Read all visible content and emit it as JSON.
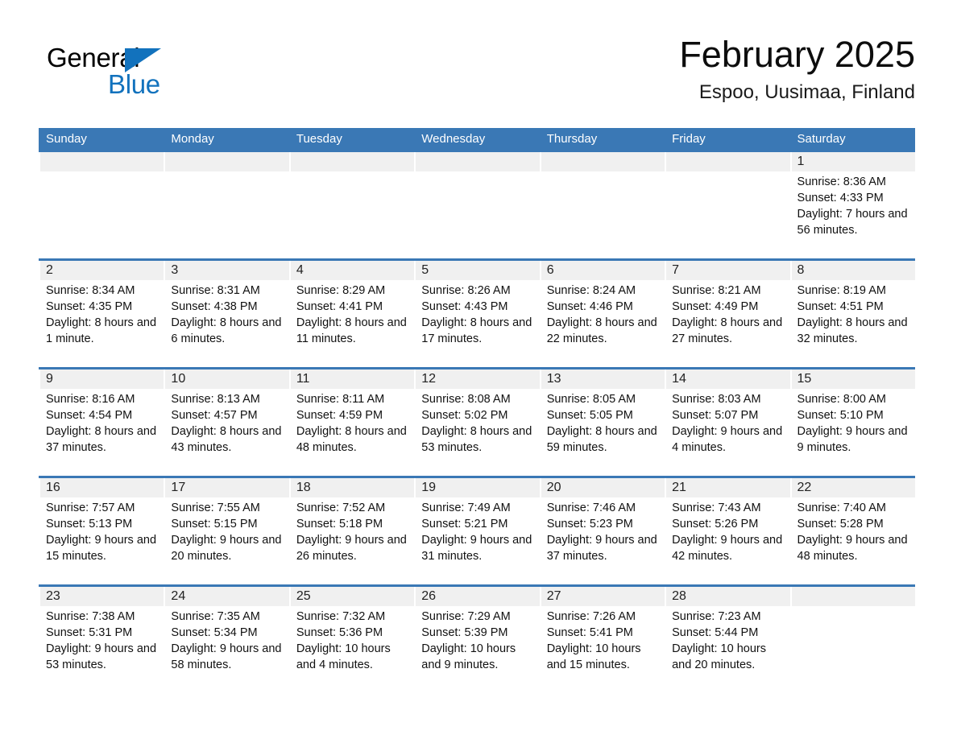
{
  "brand": {
    "name_part1": "General",
    "name_part2": "Blue",
    "triangle_icon": "triangle-icon",
    "colors": {
      "blue": "#1272bd",
      "black": "#000000"
    }
  },
  "header": {
    "title": "February 2025",
    "subtitle": "Espoo, Uusimaa, Finland"
  },
  "theme": {
    "header_blue": "#3a78b5",
    "band_gray": "#f0f0f0",
    "text": "#111111"
  },
  "weekdays": [
    "Sunday",
    "Monday",
    "Tuesday",
    "Wednesday",
    "Thursday",
    "Friday",
    "Saturday"
  ],
  "weeks": [
    [
      {
        "day": "",
        "sunrise": "",
        "sunset": "",
        "daylight": ""
      },
      {
        "day": "",
        "sunrise": "",
        "sunset": "",
        "daylight": ""
      },
      {
        "day": "",
        "sunrise": "",
        "sunset": "",
        "daylight": ""
      },
      {
        "day": "",
        "sunrise": "",
        "sunset": "",
        "daylight": ""
      },
      {
        "day": "",
        "sunrise": "",
        "sunset": "",
        "daylight": ""
      },
      {
        "day": "",
        "sunrise": "",
        "sunset": "",
        "daylight": ""
      },
      {
        "day": "1",
        "sunrise": "Sunrise: 8:36 AM",
        "sunset": "Sunset: 4:33 PM",
        "daylight": "Daylight: 7 hours and 56 minutes."
      }
    ],
    [
      {
        "day": "2",
        "sunrise": "Sunrise: 8:34 AM",
        "sunset": "Sunset: 4:35 PM",
        "daylight": "Daylight: 8 hours and 1 minute."
      },
      {
        "day": "3",
        "sunrise": "Sunrise: 8:31 AM",
        "sunset": "Sunset: 4:38 PM",
        "daylight": "Daylight: 8 hours and 6 minutes."
      },
      {
        "day": "4",
        "sunrise": "Sunrise: 8:29 AM",
        "sunset": "Sunset: 4:41 PM",
        "daylight": "Daylight: 8 hours and 11 minutes."
      },
      {
        "day": "5",
        "sunrise": "Sunrise: 8:26 AM",
        "sunset": "Sunset: 4:43 PM",
        "daylight": "Daylight: 8 hours and 17 minutes."
      },
      {
        "day": "6",
        "sunrise": "Sunrise: 8:24 AM",
        "sunset": "Sunset: 4:46 PM",
        "daylight": "Daylight: 8 hours and 22 minutes."
      },
      {
        "day": "7",
        "sunrise": "Sunrise: 8:21 AM",
        "sunset": "Sunset: 4:49 PM",
        "daylight": "Daylight: 8 hours and 27 minutes."
      },
      {
        "day": "8",
        "sunrise": "Sunrise: 8:19 AM",
        "sunset": "Sunset: 4:51 PM",
        "daylight": "Daylight: 8 hours and 32 minutes."
      }
    ],
    [
      {
        "day": "9",
        "sunrise": "Sunrise: 8:16 AM",
        "sunset": "Sunset: 4:54 PM",
        "daylight": "Daylight: 8 hours and 37 minutes."
      },
      {
        "day": "10",
        "sunrise": "Sunrise: 8:13 AM",
        "sunset": "Sunset: 4:57 PM",
        "daylight": "Daylight: 8 hours and 43 minutes."
      },
      {
        "day": "11",
        "sunrise": "Sunrise: 8:11 AM",
        "sunset": "Sunset: 4:59 PM",
        "daylight": "Daylight: 8 hours and 48 minutes."
      },
      {
        "day": "12",
        "sunrise": "Sunrise: 8:08 AM",
        "sunset": "Sunset: 5:02 PM",
        "daylight": "Daylight: 8 hours and 53 minutes."
      },
      {
        "day": "13",
        "sunrise": "Sunrise: 8:05 AM",
        "sunset": "Sunset: 5:05 PM",
        "daylight": "Daylight: 8 hours and 59 minutes."
      },
      {
        "day": "14",
        "sunrise": "Sunrise: 8:03 AM",
        "sunset": "Sunset: 5:07 PM",
        "daylight": "Daylight: 9 hours and 4 minutes."
      },
      {
        "day": "15",
        "sunrise": "Sunrise: 8:00 AM",
        "sunset": "Sunset: 5:10 PM",
        "daylight": "Daylight: 9 hours and 9 minutes."
      }
    ],
    [
      {
        "day": "16",
        "sunrise": "Sunrise: 7:57 AM",
        "sunset": "Sunset: 5:13 PM",
        "daylight": "Daylight: 9 hours and 15 minutes."
      },
      {
        "day": "17",
        "sunrise": "Sunrise: 7:55 AM",
        "sunset": "Sunset: 5:15 PM",
        "daylight": "Daylight: 9 hours and 20 minutes."
      },
      {
        "day": "18",
        "sunrise": "Sunrise: 7:52 AM",
        "sunset": "Sunset: 5:18 PM",
        "daylight": "Daylight: 9 hours and 26 minutes."
      },
      {
        "day": "19",
        "sunrise": "Sunrise: 7:49 AM",
        "sunset": "Sunset: 5:21 PM",
        "daylight": "Daylight: 9 hours and 31 minutes."
      },
      {
        "day": "20",
        "sunrise": "Sunrise: 7:46 AM",
        "sunset": "Sunset: 5:23 PM",
        "daylight": "Daylight: 9 hours and 37 minutes."
      },
      {
        "day": "21",
        "sunrise": "Sunrise: 7:43 AM",
        "sunset": "Sunset: 5:26 PM",
        "daylight": "Daylight: 9 hours and 42 minutes."
      },
      {
        "day": "22",
        "sunrise": "Sunrise: 7:40 AM",
        "sunset": "Sunset: 5:28 PM",
        "daylight": "Daylight: 9 hours and 48 minutes."
      }
    ],
    [
      {
        "day": "23",
        "sunrise": "Sunrise: 7:38 AM",
        "sunset": "Sunset: 5:31 PM",
        "daylight": "Daylight: 9 hours and 53 minutes."
      },
      {
        "day": "24",
        "sunrise": "Sunrise: 7:35 AM",
        "sunset": "Sunset: 5:34 PM",
        "daylight": "Daylight: 9 hours and 58 minutes."
      },
      {
        "day": "25",
        "sunrise": "Sunrise: 7:32 AM",
        "sunset": "Sunset: 5:36 PM",
        "daylight": "Daylight: 10 hours and 4 minutes."
      },
      {
        "day": "26",
        "sunrise": "Sunrise: 7:29 AM",
        "sunset": "Sunset: 5:39 PM",
        "daylight": "Daylight: 10 hours and 9 minutes."
      },
      {
        "day": "27",
        "sunrise": "Sunrise: 7:26 AM",
        "sunset": "Sunset: 5:41 PM",
        "daylight": "Daylight: 10 hours and 15 minutes."
      },
      {
        "day": "28",
        "sunrise": "Sunrise: 7:23 AM",
        "sunset": "Sunset: 5:44 PM",
        "daylight": "Daylight: 10 hours and 20 minutes."
      },
      {
        "day": "",
        "sunrise": "",
        "sunset": "",
        "daylight": ""
      }
    ]
  ]
}
